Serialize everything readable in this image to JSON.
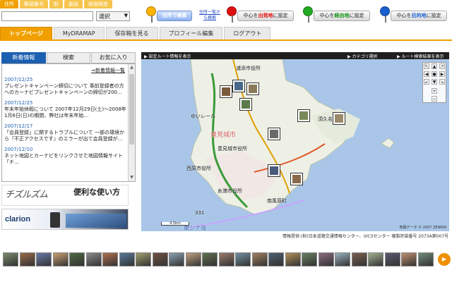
{
  "top_tabs": [
    "住所",
    "郵便番号",
    "駅",
    "施設",
    "緯度経度"
  ],
  "search": {
    "value": "",
    "select_value": "選択"
  },
  "addr_search": {
    "button": "住所で検索",
    "link": "住所一覧から検索"
  },
  "center_buttons": {
    "start": {
      "prefix": "中心を",
      "highlight": "出発地",
      "suffix": "に設定"
    },
    "via": {
      "prefix": "中心を",
      "highlight": "経由地",
      "suffix": "に設定"
    },
    "dest": {
      "prefix": "中心を",
      "highlight": "目的地",
      "suffix": "に設定"
    }
  },
  "main_nav": [
    "トップページ",
    "MyDRAMAP",
    "保存箱を見る",
    "プロフィール編集",
    "ログアウト"
  ],
  "side_tabs": [
    "新着情報",
    "検索",
    "お気に入り"
  ],
  "news": {
    "list_link": "⇒新着情報一覧",
    "items": [
      {
        "date": "2007/12/25",
        "text": "プレゼントキャンペーン締切について 事前登録者の方へのカーナビプレゼントキャンペーンの締切が200…"
      },
      {
        "date": "2007/12/25",
        "text": "年末年始休暇について 2007年12月29日(土)〜2008年1月6日(日)の期間、弊社は年末年始…"
      },
      {
        "date": "2007/12/17",
        "text": "「会員登録」に関するトラブルについて 一部の環境から『不正アクセスです』のエラーが出て会員登録が…"
      },
      {
        "date": "2007/12/10",
        "text": "ネット地図とカーナビをリンクさせた地図情報サイト「チ…"
      }
    ]
  },
  "banner1": {
    "logo": "チズルズム",
    "tagline": "便利な使い方"
  },
  "banner2": {
    "brand": "clarion"
  },
  "map_header": {
    "route_info": "設定ルート情報を表示",
    "category": "カテゴリ選択",
    "route_result": "ルート検索結果を表示"
  },
  "map_labels": {
    "city1": "浦添市役所",
    "city2": "豊見城市",
    "city3": "豊見城市役所",
    "city4": "西原市役所",
    "city5": "糸満市役所",
    "city6": "南風原町",
    "city7": "須久名山",
    "road": "331",
    "sea": "東シナ海",
    "ic": "ゆいレール"
  },
  "map_scale": "4.5km",
  "map_copyright": "地図データ © 2007 ZENRIN",
  "credit": "情報提供:(財)日本道路交通情報センター、VICSセンター 複製許諾番号 2073A第007号",
  "thumbnail_colors": [
    "#7a8a6a",
    "#9a6a4a",
    "#6a7aa8",
    "#c8a070",
    "#506a40",
    "#8a8a8a",
    "#b07050",
    "#5a7a9a",
    "#a0a070",
    "#705040",
    "#8aa0b0",
    "#c0a080",
    "#607050",
    "#9a7a6a",
    "#7090a0",
    "#a08060",
    "#506070",
    "#b0905a",
    "#6a8060",
    "#8a6a80",
    "#9ab0c0",
    "#7a6050",
    "#a0b090",
    "#5a5a70",
    "#c09070",
    "#708a7a"
  ]
}
